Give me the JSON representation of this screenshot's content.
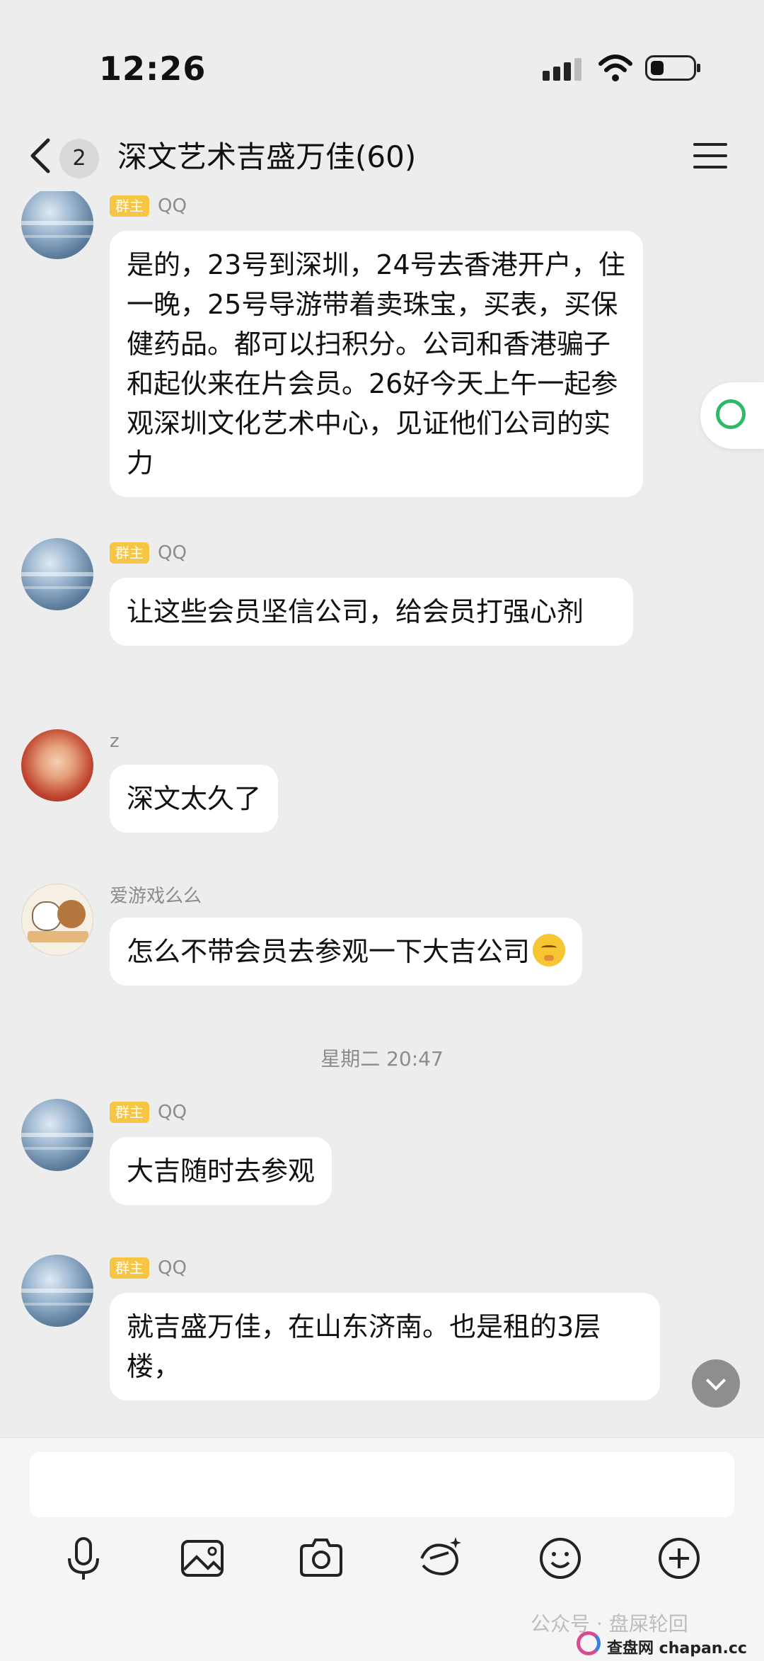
{
  "status_bar": {
    "time": "12:26"
  },
  "nav": {
    "unread_count": "2",
    "title": "深文艺术吉盛万佳(60)"
  },
  "messages": [
    {
      "sender": "QQ",
      "badge": "群主",
      "text": "是的，23号到深圳，24号去香港开户，住一晚，25号导游带着卖珠宝，买表，买保健药品。都可以扫积分。公司和香港骗子和起伙来在片会员。26好今天上午一起参观深圳文化艺术中心，见证他们公司的实力"
    },
    {
      "sender": "QQ",
      "badge": "群主",
      "text": "让这些会员坚信公司，给会员打强心剂"
    },
    {
      "sender": "z",
      "badge": "",
      "text": "深文太久了"
    },
    {
      "sender": "爱游戏么么",
      "badge": "",
      "text": "怎么不带会员去参观一下大吉公司"
    },
    {
      "sender": "QQ",
      "badge": "群主",
      "text": "大吉随时去参观"
    },
    {
      "sender": "QQ",
      "badge": "群主",
      "text": "就吉盛万佳，在山东济南。也是租的3层楼，"
    }
  ],
  "timestamp": "星期二 20:47",
  "input": {
    "placeholder": ""
  },
  "toolbar": [
    "microphone-icon",
    "image-icon",
    "camera-icon",
    "red-packet-icon",
    "emoji-icon",
    "plus-icon"
  ],
  "watermark": {
    "text": "公众号 · 盘屎轮回",
    "site": "查盘网 chapan.cc"
  },
  "colors": {
    "background": "#ededed",
    "bubble": "#ffffff",
    "owner_badge": "#f6c544",
    "side_float_accent": "#2fb86a"
  }
}
